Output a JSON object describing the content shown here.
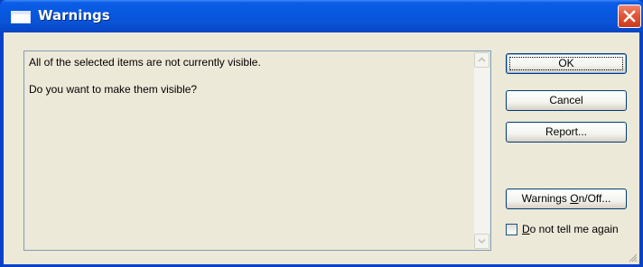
{
  "window": {
    "title": "Warnings",
    "colors": {
      "titlebar": "#0a53d6",
      "client": "#ece9d8",
      "close": "#e2573a"
    }
  },
  "message": {
    "line1": "All of the selected items are not currently visible.",
    "line2": "Do you want to make them visible?"
  },
  "buttons": {
    "ok": "OK",
    "cancel": "Cancel",
    "report": "Report...",
    "warnings_prefix": "Warnings ",
    "warnings_mnemonic": "O",
    "warnings_suffix": "n/Off..."
  },
  "checkbox": {
    "mnemonic": "D",
    "label_rest": "o not tell me again",
    "checked": false
  },
  "icons": {
    "window": "window-icon",
    "close": "close-icon",
    "scroll_up": "scroll-up-arrow-icon",
    "scroll_down": "scroll-down-arrow-icon",
    "grip": "resize-grip-icon"
  }
}
